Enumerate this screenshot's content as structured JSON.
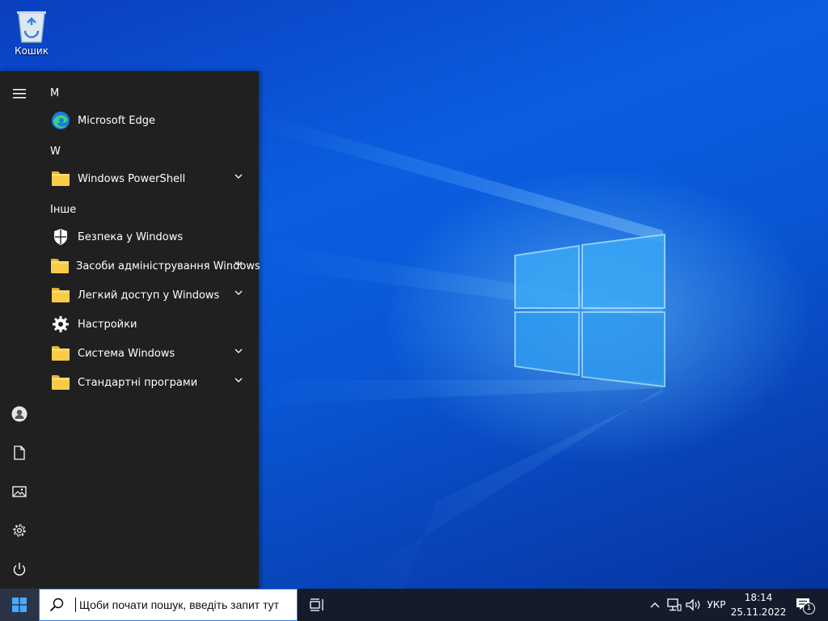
{
  "desktop": {
    "recycle_bin_label": "Кошик"
  },
  "start_menu": {
    "sections": [
      {
        "letter": "M"
      },
      {
        "letter": "W"
      },
      {
        "letter": "Інше"
      }
    ],
    "apps": [
      {
        "label": "Microsoft Edge",
        "icon": "edge-icon",
        "expandable": false
      },
      {
        "label": "Windows PowerShell",
        "icon": "folder-icon",
        "expandable": true
      },
      {
        "label": "Безпека у Windows",
        "icon": "shield-icon",
        "expandable": false
      },
      {
        "label": "Засоби адміністрування Windows",
        "icon": "folder-icon",
        "expandable": true
      },
      {
        "label": "Легкий доступ у Windows",
        "icon": "folder-icon",
        "expandable": true
      },
      {
        "label": "Настройки",
        "icon": "gear-icon",
        "expandable": false
      },
      {
        "label": "Система Windows",
        "icon": "folder-icon",
        "expandable": true
      },
      {
        "label": "Стандартні програми",
        "icon": "folder-icon",
        "expandable": true
      }
    ],
    "rail": [
      "hamburger-icon",
      "user-icon",
      "documents-icon",
      "pictures-icon",
      "settings-icon",
      "power-icon"
    ]
  },
  "taskbar": {
    "search_placeholder": "Щоби почати пошук, введіть запит тут",
    "language": "УКР",
    "time": "18:14",
    "date": "25.11.2022",
    "notification_count": "1"
  },
  "colors": {
    "start_menu_bg": "#202020",
    "taskbar_bg": "#141c2c",
    "desktop_blue": "#0b5ee0"
  }
}
